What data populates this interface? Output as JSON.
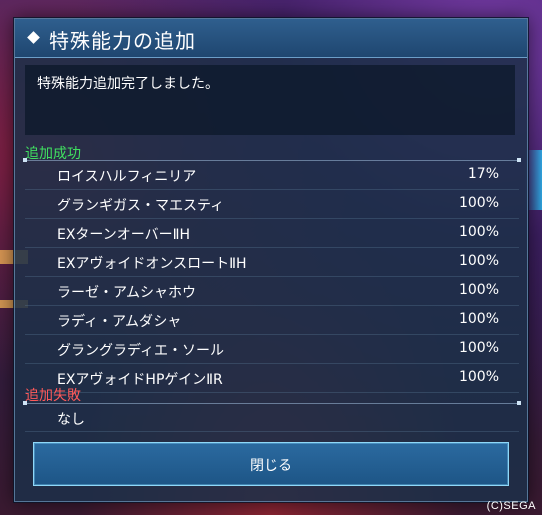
{
  "dialog": {
    "title": "特殊能力の追加",
    "message": "特殊能力追加完了しました。"
  },
  "success": {
    "label": "追加成功",
    "items": [
      {
        "name": "ロイスハルフィニリア",
        "rate": "17%"
      },
      {
        "name": "グランギガス・マエスティ",
        "rate": "100%"
      },
      {
        "name": "EXターンオーバーⅡH",
        "rate": "100%"
      },
      {
        "name": "EXアヴォイドオンスロートⅡH",
        "rate": "100%"
      },
      {
        "name": "ラーゼ・アムシャホウ",
        "rate": "100%"
      },
      {
        "name": "ラディ・アムダシャ",
        "rate": "100%"
      },
      {
        "name": "グラングラディエ・ソール",
        "rate": "100%"
      },
      {
        "name": "EXアヴォイドHPゲインⅡR",
        "rate": "100%"
      }
    ]
  },
  "failure": {
    "label": "追加失敗",
    "items": [
      {
        "name": "なし"
      }
    ]
  },
  "close_button": {
    "label": "閉じる"
  },
  "copyright": "(C)SEGA",
  "icons": {
    "title_marker": "diamond-icon"
  },
  "colors": {
    "success_label": "#40e060",
    "failure_label": "#ff5a5a",
    "button_border": "#8fd8f8"
  }
}
